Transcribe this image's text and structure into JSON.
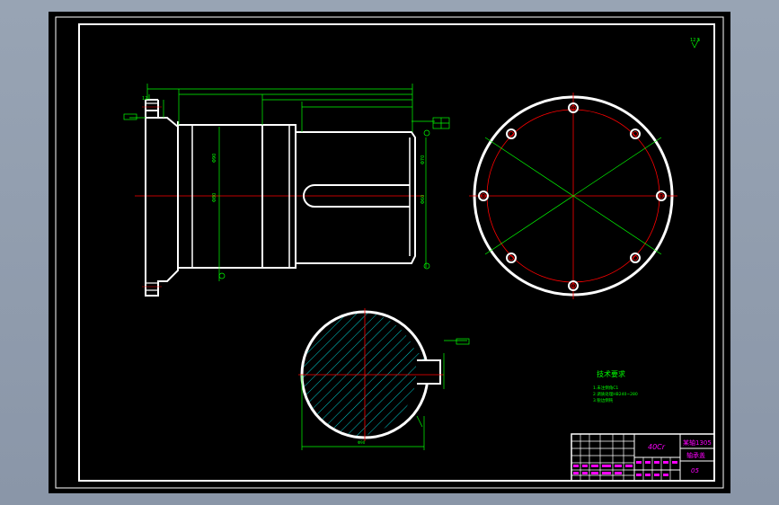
{
  "colors": {
    "background": "#000000",
    "outline": "#ffffff",
    "dimension": "#00ff00",
    "centerline": "#ff0000",
    "hatch": "#00ffff",
    "title_text": "#ff00ff"
  },
  "notes": {
    "heading": "技术要求",
    "lines": [
      "1.未注倒角C1",
      "2.调质处理HB240~280",
      "3.锐边倒钝"
    ]
  },
  "title_block": {
    "material": "40Cr",
    "part_name": "轴承盖",
    "drawing_no": "05",
    "project": "某轴1305"
  },
  "view_labels": {
    "roughness": "12.5"
  }
}
